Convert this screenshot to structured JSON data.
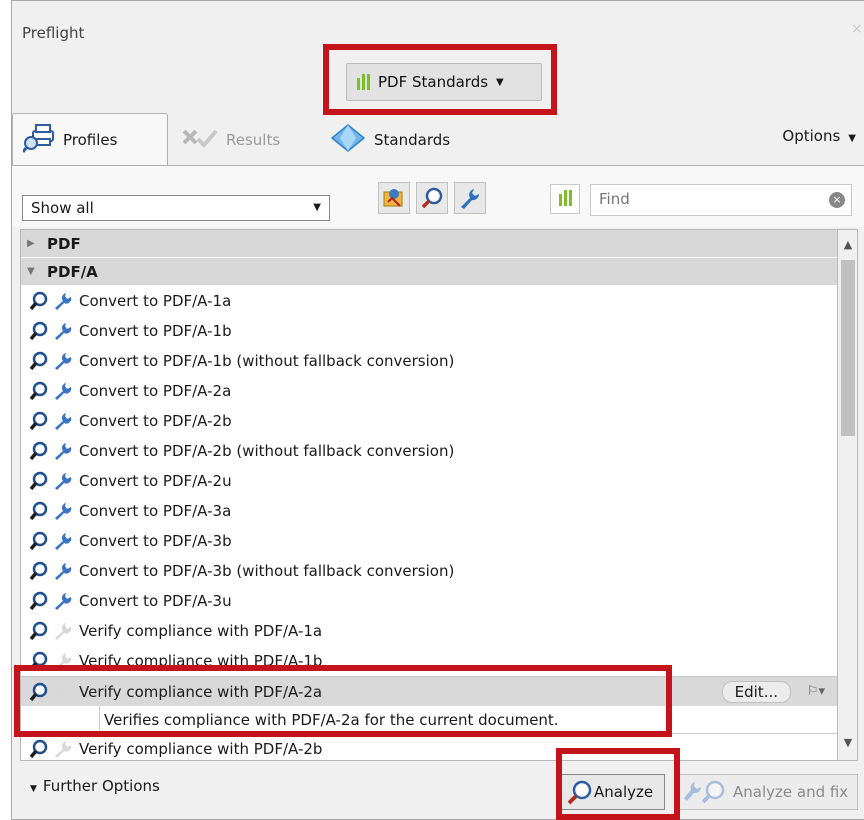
{
  "window": {
    "title": "Preflight",
    "close": "×"
  },
  "profile_dropdown": {
    "label": "PDF Standards"
  },
  "tabs": [
    {
      "label": "Profiles",
      "icon": "printer-magnifier-icon",
      "active": true
    },
    {
      "label": "Results",
      "icon": "results-icon",
      "active": false
    },
    {
      "label": "Standards",
      "icon": "diamond-icon",
      "active": false
    }
  ],
  "options": {
    "label": "Options"
  },
  "toolbar": {
    "filter_value": "Show all",
    "find_placeholder": "Find"
  },
  "list": {
    "groups": [
      {
        "label": "PDF",
        "expanded": false
      },
      {
        "label": "PDF/A",
        "expanded": true
      }
    ],
    "items": [
      "Convert to PDF/A-1a",
      "Convert to PDF/A-1b",
      "Convert to PDF/A-1b (without fallback conversion)",
      "Convert to PDF/A-2a",
      "Convert to PDF/A-2b",
      "Convert to PDF/A-2b (without fallback conversion)",
      "Convert to PDF/A-2u",
      "Convert to PDF/A-3a",
      "Convert to PDF/A-3b",
      "Convert to PDF/A-3b (without fallback conversion)",
      "Convert to PDF/A-3u",
      "Verify compliance with PDF/A-1a",
      "Verify compliance with PDF/A-1b",
      "Verify compliance with PDF/A-2a",
      "Verify compliance with PDF/A-2b"
    ],
    "selected": {
      "label": "Verify compliance with PDF/A-2a",
      "edit_label": "Edit...",
      "description": "Verifies compliance with PDF/A-2a for the current document."
    }
  },
  "bottom": {
    "further_options": "Further Options",
    "analyze": "Analyze",
    "analyze_and_fix": "Analyze and fix"
  },
  "colors": {
    "highlight": "#c4131a",
    "accent_green": "#7cbf2a"
  }
}
